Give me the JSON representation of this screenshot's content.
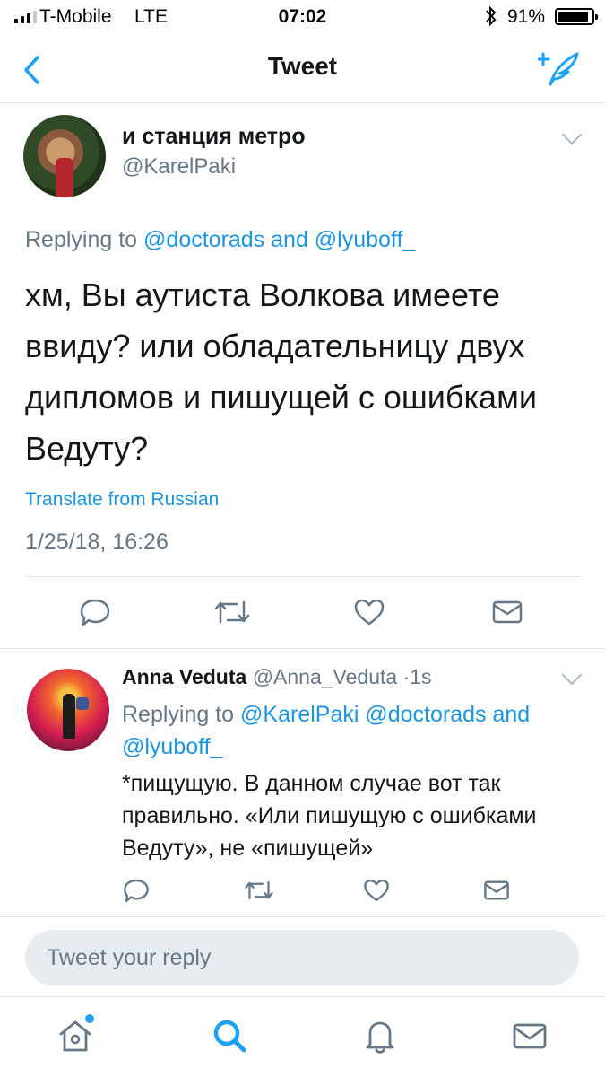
{
  "status_bar": {
    "carrier": "T-Mobile",
    "network": "LTE",
    "time": "07:02",
    "battery": "91%",
    "battery_level": 0.91,
    "signal_bars": 3
  },
  "nav": {
    "title": "Tweet",
    "back_icon": "chevron-left-icon",
    "compose_icon": "compose-tweet-icon",
    "accent": "#1da1f2"
  },
  "main_tweet": {
    "display_name": "и станция метро",
    "handle": "@KarelPaki",
    "replying_prefix": "Replying to",
    "replying_to": "@doctorads and @lyuboff_",
    "text": "хм, Вы аутиста Волкова имеете ввиду? или обладательницу двух дипломов и пишущей с ошибками Ведуту?",
    "translate": "Translate from Russian",
    "timestamp": "1/25/18, 16:26"
  },
  "reply_tweet": {
    "display_name": "Anna Veduta",
    "handle": "@Anna_Veduta",
    "separator": "·",
    "time": "1s",
    "replying_prefix": "Replying to",
    "replying_to": "@KarelPaki @doctorads and @lyuboff_",
    "text": "*пищущую. В данном случае вот так правильно. «Или пишущую с ошибками Ведуту», не «пишущей»"
  },
  "reply_box": {
    "placeholder": "Tweet your reply"
  },
  "actions": [
    "reply-icon",
    "retweet-icon",
    "like-icon",
    "direct-message-icon"
  ],
  "tab_bar": [
    "home-icon",
    "search-icon",
    "notifications-icon",
    "messages-icon"
  ],
  "colors": {
    "link": "#1b95e0",
    "secondary_text": "#657786",
    "divider": "#e1e8ed"
  }
}
